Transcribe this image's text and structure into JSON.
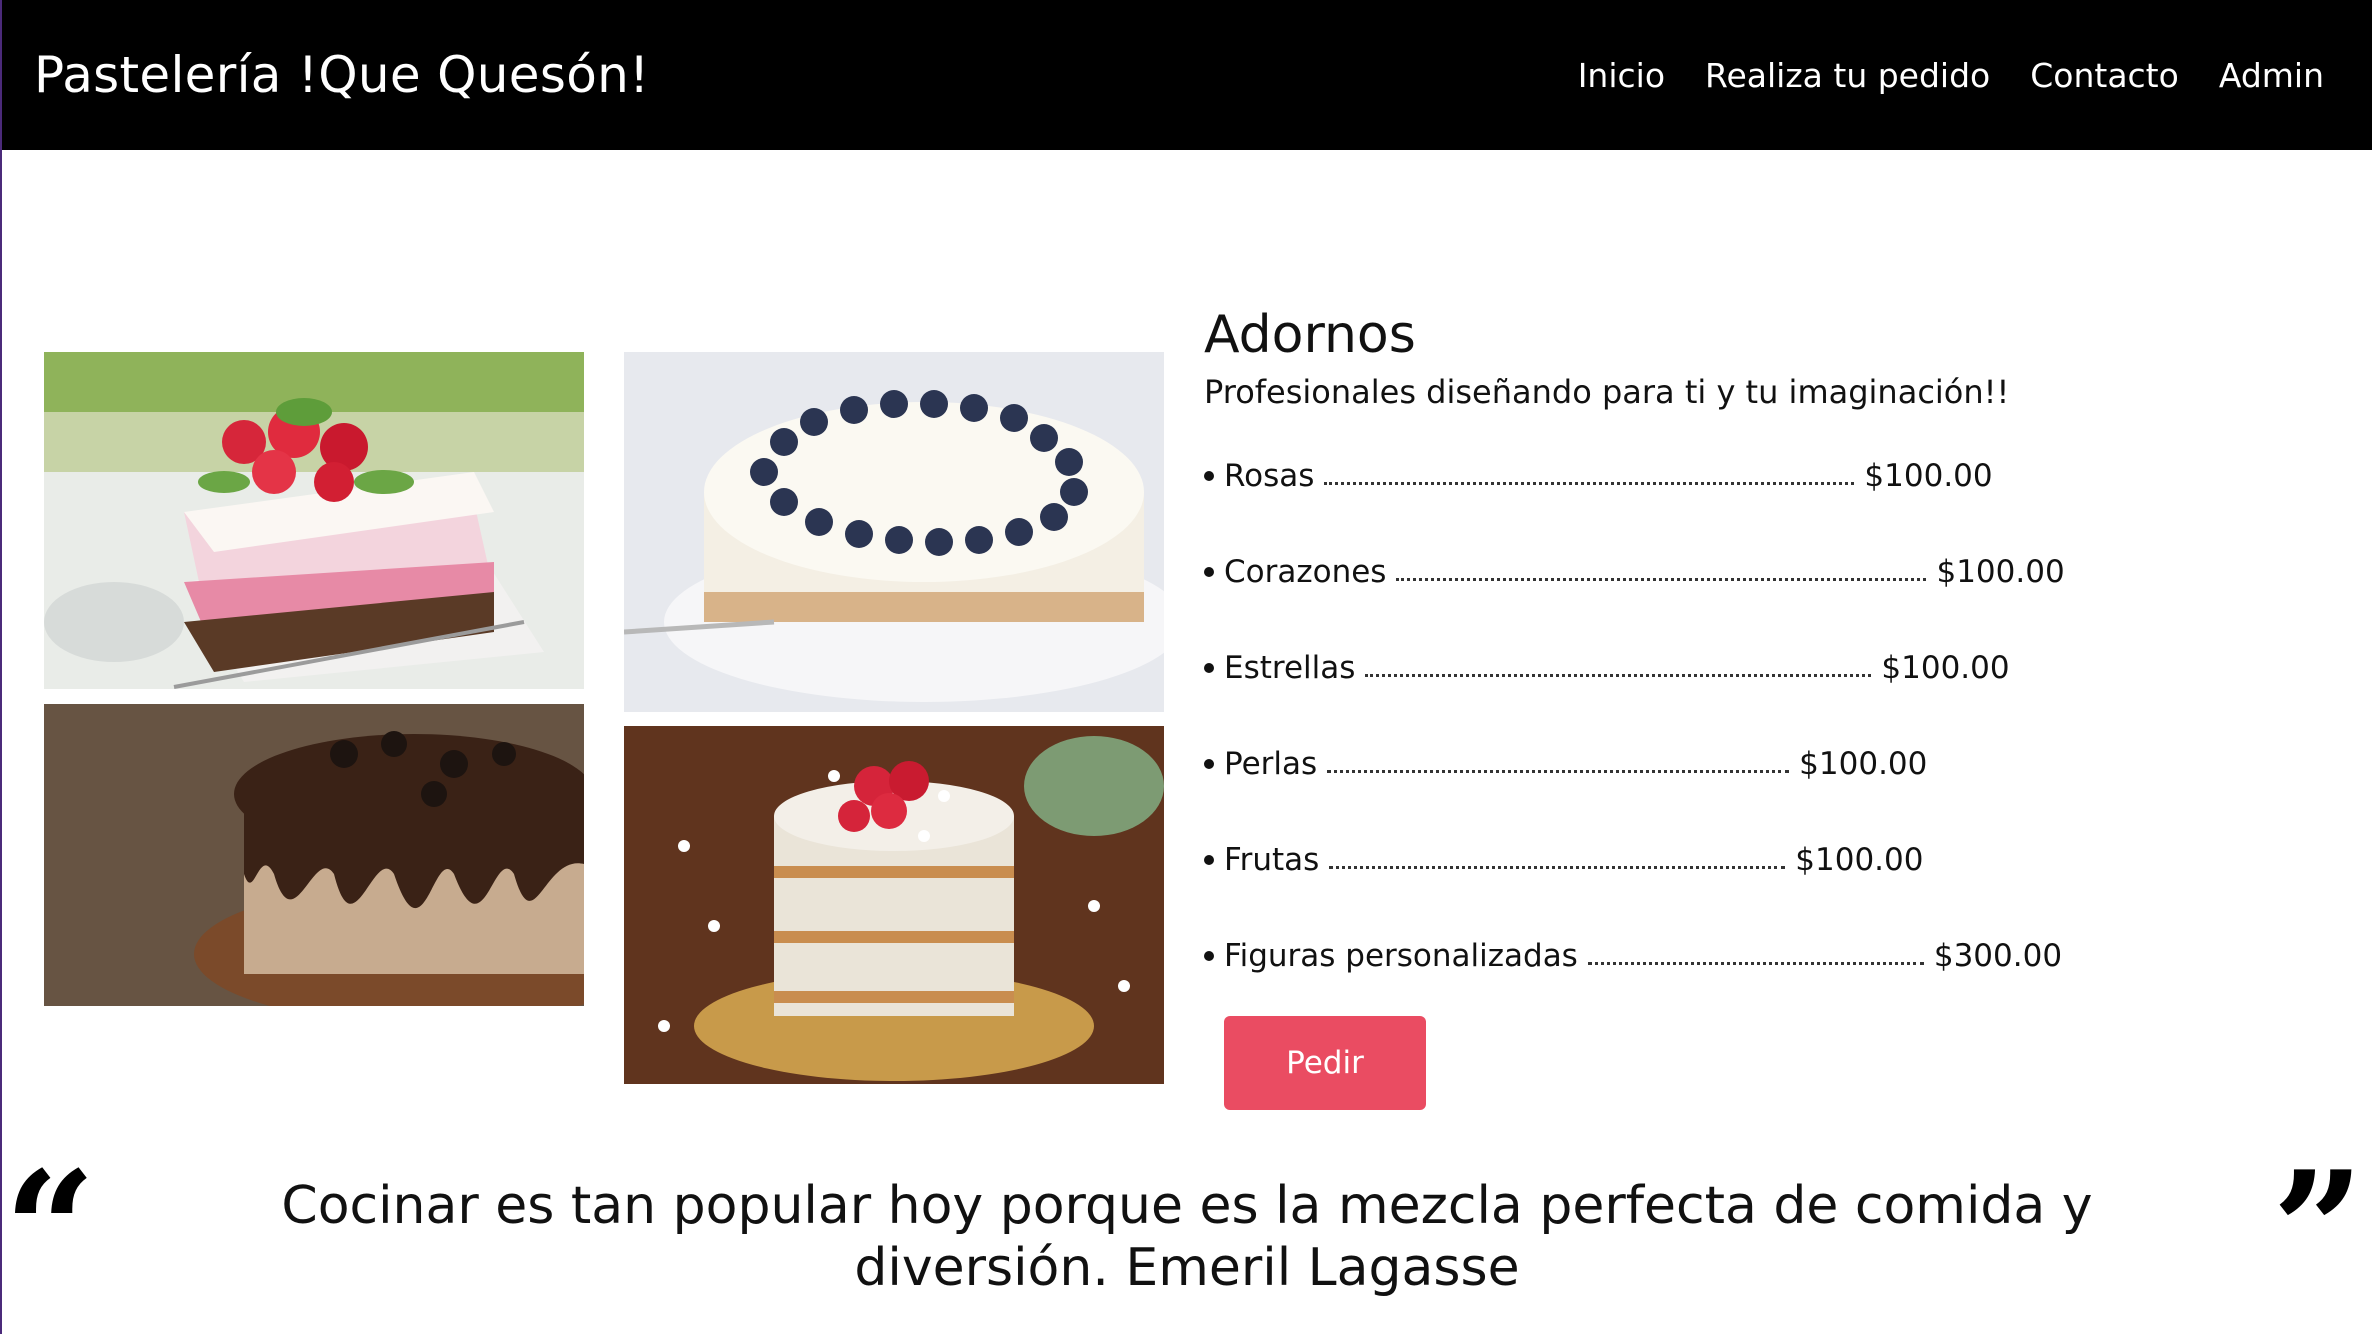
{
  "header": {
    "brand": "Pastelería !Que Quesón!",
    "nav": [
      "Inicio",
      "Realiza tu pedido",
      "Contacto",
      "Admin"
    ]
  },
  "menu": {
    "title": "Adornos",
    "subtitle": "Profesionales diseñando para ti y tu imaginación!!",
    "items": [
      {
        "name": "Rosas",
        "price": "$100.00"
      },
      {
        "name": "Corazones",
        "price": "$100.00"
      },
      {
        "name": "Estrellas",
        "price": "$100.00"
      },
      {
        "name": "Perlas",
        "price": "$100.00"
      },
      {
        "name": "Frutas",
        "price": "$100.00"
      },
      {
        "name": "Figuras personalizadas",
        "price": "$300.00"
      }
    ],
    "order_button": "Pedir"
  },
  "quote": {
    "open_mark": "“",
    "text": "Cocinar es tan popular hoy porque es la mezcla perfecta de comida y diversión. Emeril Lagasse",
    "close_mark": "”"
  },
  "colors": {
    "navbar": "#000000",
    "accent": "#ea4c62"
  }
}
